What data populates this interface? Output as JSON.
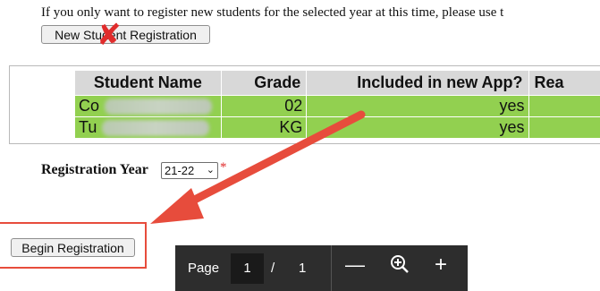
{
  "intro_text": "If you only want to register new students for the selected year at this time, please use t",
  "new_student_button": "New Student Registration",
  "table": {
    "headers": [
      "Student Name",
      "Grade",
      "Included in new App?",
      "Rea"
    ],
    "rows": [
      {
        "name": "Co",
        "grade": "02",
        "included": "yes"
      },
      {
        "name": "Tu",
        "grade": "KG",
        "included": "yes"
      }
    ]
  },
  "registration_year_label": "Registration Year",
  "registration_year_value": "21-22",
  "required_marker": "*",
  "begin_registration_button": "Begin Registration",
  "pdf_toolbar": {
    "page_label": "Page",
    "current_page": "1",
    "separator": "/",
    "total_pages": "1",
    "zoom_out": "—",
    "zoom_in": "+"
  },
  "colors": {
    "row_green": "#92d050",
    "header_gray": "#d8d8d8",
    "annotation_red": "#e74c3c"
  }
}
